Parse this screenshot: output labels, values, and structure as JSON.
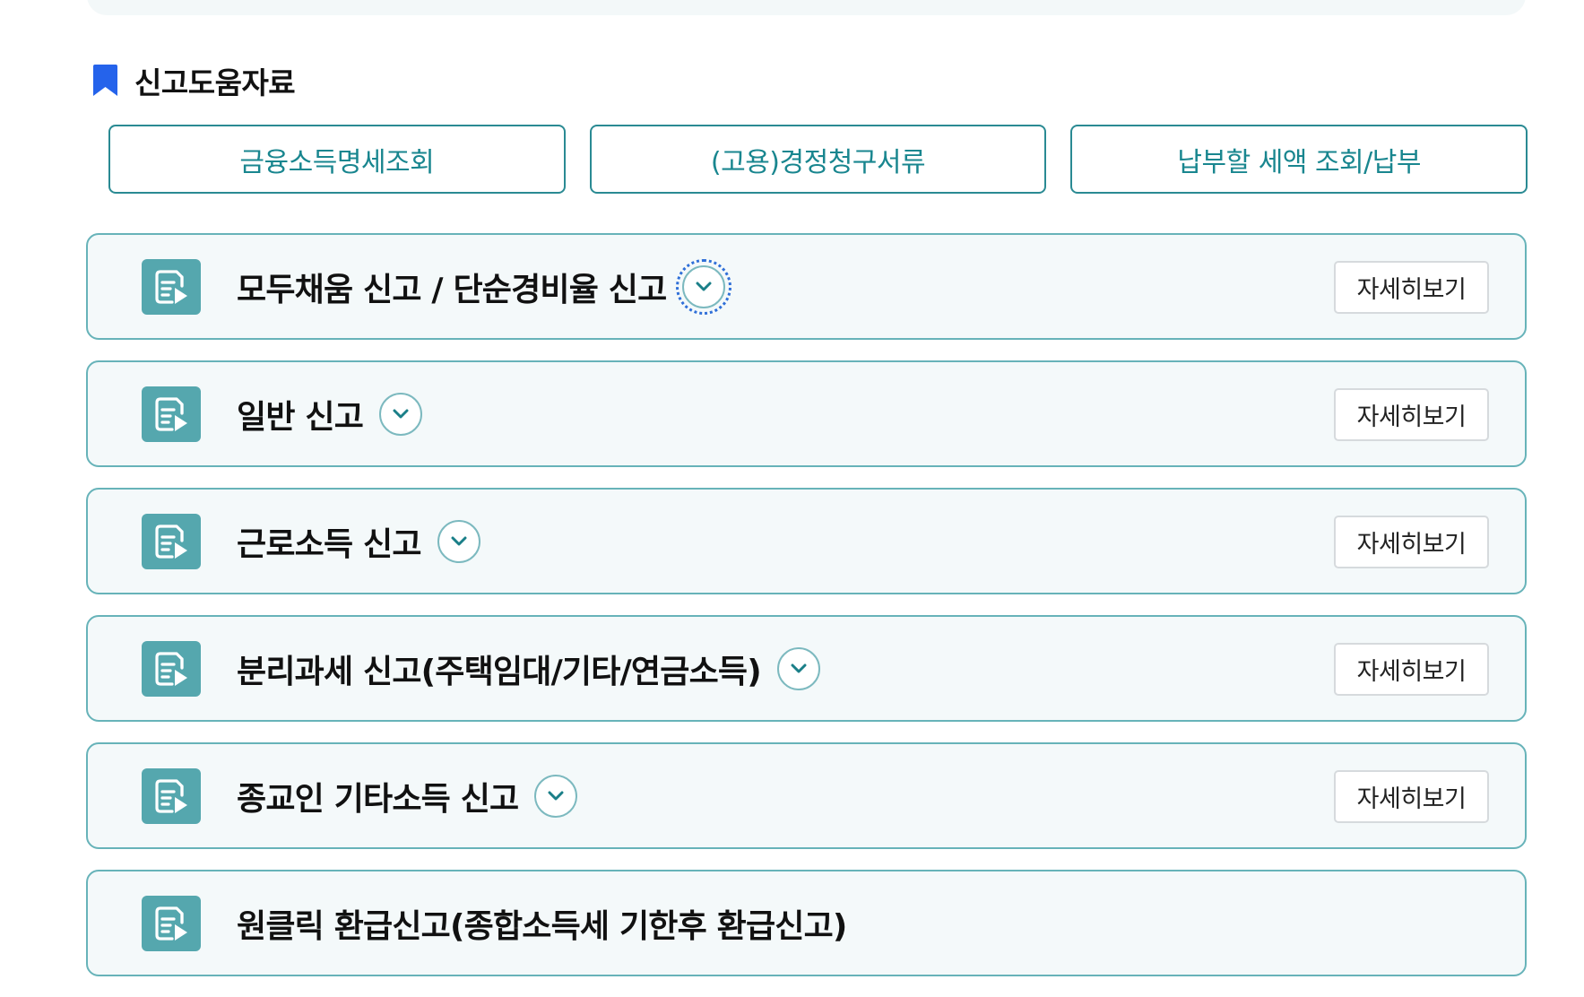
{
  "section": {
    "title": "신고도움자료",
    "icon": "bookmark-icon",
    "accent_color": "#2563eb"
  },
  "quick_links": [
    {
      "label": "금융소득명세조회"
    },
    {
      "label": "(고용)경정청구서류"
    },
    {
      "label": "납부할 세액 조회/납부"
    }
  ],
  "items": [
    {
      "title": "모두채움 신고 / 단순경비율 신고",
      "detail_label": "자세히보기",
      "icon": "document-edit-icon"
    },
    {
      "title": "일반 신고",
      "detail_label": "자세히보기",
      "icon": "document-edit-icon"
    },
    {
      "title": "근로소득 신고",
      "detail_label": "자세히보기",
      "icon": "document-edit-icon"
    },
    {
      "title": "분리과세 신고(주택임대/기타/연금소득)",
      "detail_label": "자세히보기",
      "icon": "document-edit-icon"
    },
    {
      "title": "종교인 기타소득 신고",
      "detail_label": "자세히보기",
      "icon": "document-edit-icon"
    },
    {
      "title": "원클릭 환급신고(종합소득세 기한후 환급신고)",
      "icon": "document-edit-icon"
    }
  ],
  "colors": {
    "teal_border": "#67b3b9",
    "teal_text": "#19868f",
    "icon_bg": "#55a7ae",
    "item_bg": "#f4f9fa"
  }
}
